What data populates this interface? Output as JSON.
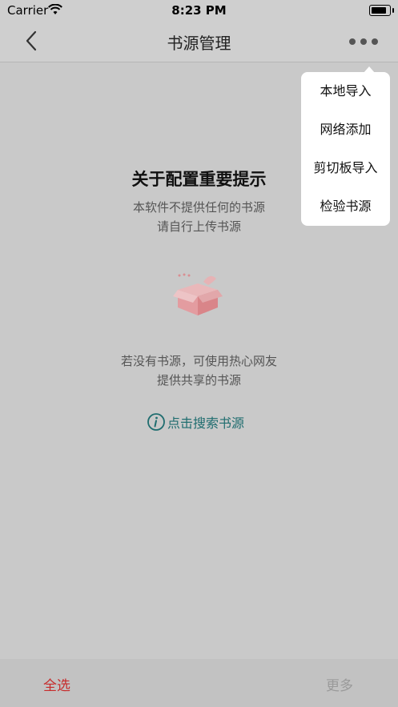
{
  "status_bar": {
    "carrier": "Carrier",
    "time": "8:23 PM"
  },
  "nav": {
    "title": "书源管理",
    "back_icon": "chevron-left-icon",
    "more_icon": "more-dots-icon"
  },
  "notice": {
    "title": "关于配置重要提示",
    "line1": "本软件不提供任何的书源",
    "line2": "请自行上传书源"
  },
  "hint": {
    "line1": "若没有书源，可使用热心网友",
    "line2": "提供共享的书源",
    "search_link": "点击搜索书源"
  },
  "menu": {
    "items": [
      {
        "label": "本地导入"
      },
      {
        "label": "网络添加"
      },
      {
        "label": "剪切板导入"
      },
      {
        "label": "检验书源"
      }
    ]
  },
  "bottom": {
    "select_all": "全选",
    "more": "更多"
  },
  "colors": {
    "accent_red": "#c72b2b",
    "link_teal": "#1f6d6f",
    "overlay_gray": "#c9c9c9",
    "box_pink": "#e8a3a6"
  }
}
